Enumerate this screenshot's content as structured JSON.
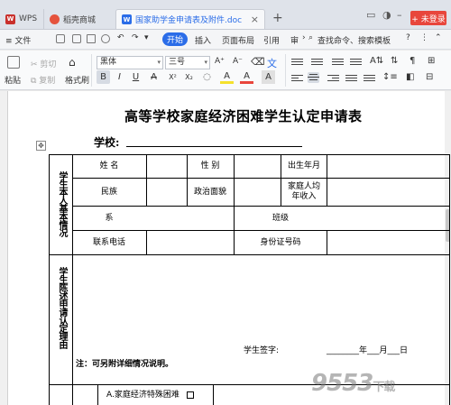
{
  "tabs": [
    {
      "label": "WPS"
    },
    {
      "label": "稻壳商城"
    },
    {
      "label": "国家助学金申请表及附件.doc"
    }
  ],
  "login_label": "+ 未登录",
  "menu": {
    "file": "≡ 文件",
    "start": "开始",
    "items": [
      "插入",
      "页面布局",
      "引用",
      "审"
    ],
    "search": "查找命令、搜索模板",
    "help": "?"
  },
  "ribbon": {
    "paste": "粘贴",
    "cut": "剪切",
    "copy": "复制",
    "format_painter": "格式刷",
    "font_name": "黑体",
    "font_size": "三号",
    "grow": "A⁺",
    "shrink": "A⁻",
    "bold": "B",
    "italic": "I",
    "underline": "U",
    "strike": "A",
    "sup": "X²",
    "sub": "X₂",
    "highlight": "A",
    "color": "A",
    "charshade": "A"
  },
  "document": {
    "title": "高等学校家庭经济困难学生认定申请表",
    "school_label": "学校:",
    "section1": "学生本人基本情况",
    "section2": "学生陈述申请认定理由",
    "cells": {
      "name": "姓  名",
      "gender": "性  别",
      "birth": "出生年月",
      "ethnicity": "民族",
      "political": "政治面貌",
      "income": "家庭人均\n年收入",
      "dept": "系",
      "class": "班级",
      "phone": "联系电话",
      "id": "身份证号码"
    },
    "signature": "学生签字:",
    "date": "________年___月___日",
    "note": "注：可另附详细情况说明。",
    "option_a": "A.家庭经济特殊困难"
  },
  "watermark": "9553",
  "watermark_suffix": "下载"
}
